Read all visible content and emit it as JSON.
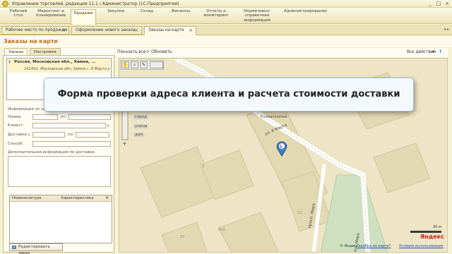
{
  "window": {
    "title": "Управление торговлей, редакция 11.1 / Администратор (1С:Предприятие)",
    "controls": [
      "_",
      "□",
      "×"
    ]
  },
  "sections": [
    {
      "label": "Рабочий стол"
    },
    {
      "label": "Маркетинг и планирование"
    },
    {
      "label": "Продажи",
      "active": true
    },
    {
      "label": "Закупки"
    },
    {
      "label": "Склад"
    },
    {
      "label": "Финансы"
    },
    {
      "label": "Отчеты и мониторинг"
    },
    {
      "label": "Нормативно-справочная информация"
    },
    {
      "label": "Администрирование"
    }
  ],
  "open_tabs": [
    {
      "label": "Рабочее место по продажам"
    },
    {
      "label": "Оформление нового заказа"
    },
    {
      "label": "Заказы на карте",
      "active": true
    }
  ],
  "form": {
    "title": "Заказы на карте",
    "left_tabs": [
      "Заказы",
      "Настройки"
    ],
    "order": {
      "number": "1",
      "line1": "Россия, Московская обл., Химки, ...",
      "line2": "141401, Московская обл, Химки г, 8 Марта ул..."
    },
    "fields": {
      "info_label": "Информация по заказу",
      "number_label": "Номер:",
      "from_label": "от:",
      "client_label": "Клиент:",
      "delivery_label": "Доставка с:",
      "to_label": "по:",
      "method_label": "Способ:",
      "extra_label": "Дополнительная информация по доставке:"
    },
    "grid": {
      "columns": [
        "Номенклатура",
        "Характеристика",
        "К"
      ]
    },
    "edit_button": "Редактировать заказ",
    "commands": {
      "show_all": "Показать все",
      "refresh": "Обновить",
      "all_actions": "Все действия"
    }
  },
  "map": {
    "street_labels": [
      "ул. 8 Марта",
      "просп. Мира",
      "просп. Мира"
    ],
    "district_labels": [
      "город",
      "улица",
      "дом"
    ],
    "poi": "Стоматология",
    "building_numbers": [
      "3",
      "23",
      "2/1",
      "25A",
      "10"
    ],
    "marker_number": "1",
    "scale": "30 м",
    "footer_links": [
      "© Яндекс",
      "Ошибка на карте?",
      "Условия использования"
    ],
    "brand": "Яндекс"
  },
  "callout": {
    "text": "Форма проверки адреса клиента и расчета стоимости доставки"
  },
  "colors": {
    "accent_title": "#b86c16",
    "map_road": "#ffffff",
    "map_building": "#e2d9b3",
    "map_green": "#cfe0c0"
  }
}
